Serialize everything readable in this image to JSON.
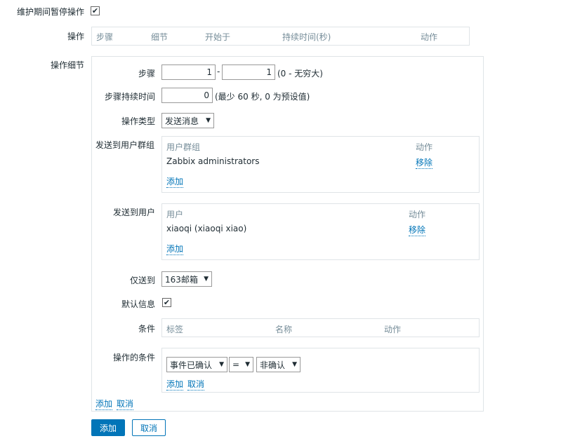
{
  "pause_maintenance": {
    "label": "维护期间暂停操作",
    "checked": true
  },
  "operations": {
    "label": "操作",
    "headers": [
      "步骤",
      "细节",
      "开始于",
      "持续时间(秒)",
      "动作"
    ]
  },
  "details": {
    "label": "操作细节",
    "step": {
      "label": "步骤",
      "from": "1",
      "separator": "-",
      "to": "1",
      "hint": "(0 - 无穷大)"
    },
    "step_duration": {
      "label": "步骤持续时间",
      "value": "0",
      "hint": "(最少 60 秒, 0 为预设值)"
    },
    "op_type": {
      "label": "操作类型",
      "value": "发送消息"
    },
    "send_to_groups": {
      "label": "发送到用户群组",
      "col_group": "用户群组",
      "col_action": "动作",
      "rows": [
        {
          "name": "Zabbix administrators",
          "action": "移除"
        }
      ],
      "add": "添加"
    },
    "send_to_users": {
      "label": "发送到用户",
      "col_user": "用户",
      "col_action": "动作",
      "rows": [
        {
          "name": "xiaoqi (xiaoqi xiao)",
          "action": "移除"
        }
      ],
      "add": "添加"
    },
    "send_only_to": {
      "label": "仅送到",
      "value": "163邮箱"
    },
    "default_message": {
      "label": "默认信息",
      "checked": true
    },
    "conditions": {
      "label": "条件",
      "headers": [
        "标签",
        "名称",
        "动作"
      ]
    },
    "op_conditions": {
      "label": "操作的条件",
      "field": "事件已确认",
      "operator": "=",
      "value": "非确认",
      "add": "添加",
      "cancel": "取消"
    },
    "add": "添加",
    "cancel": "取消"
  },
  "footer": {
    "add_button": "添加",
    "cancel_button": "取消"
  },
  "colors": {
    "link": "#0275b8",
    "header": "#768d99",
    "border": "#dfe4e7",
    "primary": "#0275b8"
  }
}
